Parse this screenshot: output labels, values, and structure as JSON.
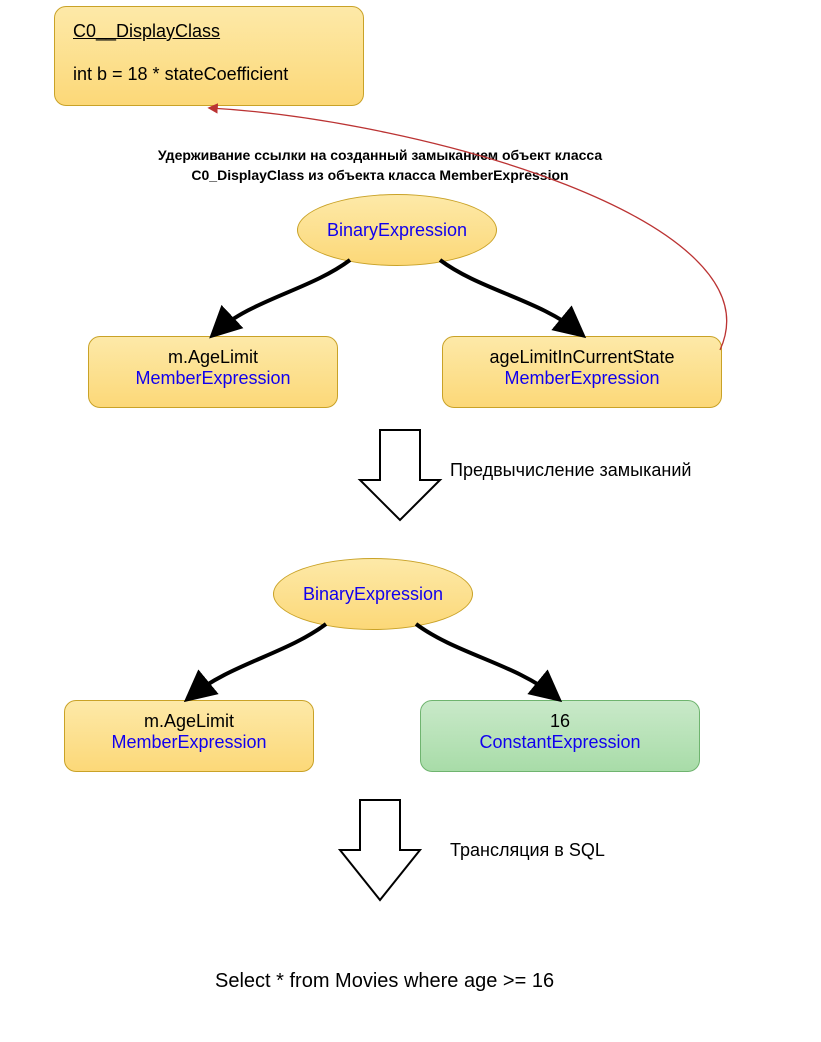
{
  "display_class": {
    "title": "C0__DisplayClass",
    "field": "int b = 18 * stateCoefficient"
  },
  "caption": {
    "line1": "Удерживание ссылки на созданный замыканием объект класса",
    "line2": "C0_DisplayClass из объекта класса MemberExpression"
  },
  "tree1": {
    "root": "BinaryExpression",
    "left": {
      "top": "m.AgeLimit",
      "bottom": "MemberExpression"
    },
    "right": {
      "top": "ageLimitInCurrentState",
      "bottom": "MemberExpression"
    }
  },
  "arrow1_label": "Предвычисление замыканий",
  "tree2": {
    "root": "BinaryExpression",
    "left": {
      "top": "m.AgeLimit",
      "bottom": "MemberExpression"
    },
    "right": {
      "top": "16",
      "bottom": "ConstantExpression"
    }
  },
  "arrow2_label": "Трансляция в SQL",
  "sql_output": "Select * from Movies where age >= 16"
}
